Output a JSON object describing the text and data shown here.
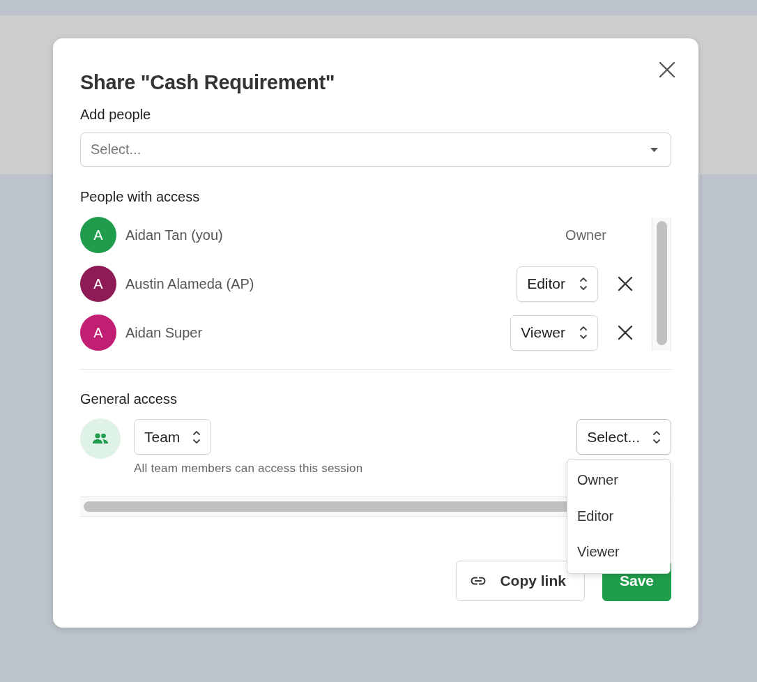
{
  "dialog": {
    "title": "Share \"Cash Requirement\""
  },
  "add_people": {
    "label": "Add people",
    "placeholder": "Select..."
  },
  "people_with_access": {
    "label": "People with access",
    "people": [
      {
        "initial": "A",
        "name": "Aidan Tan (you)",
        "color": "#1f9d4c",
        "kind": "fixed",
        "role": "Owner"
      },
      {
        "initial": "A",
        "name": "Austin Alameda (AP)",
        "color": "#8e1a56",
        "kind": "select",
        "role": "Editor"
      },
      {
        "initial": "A",
        "name": "Aidan Super",
        "color": "#c01f74",
        "kind": "select",
        "role": "Viewer"
      }
    ]
  },
  "general_access": {
    "label": "General access",
    "scope": "Team",
    "description": "All team members can access this session",
    "role_select": {
      "value": "Select...",
      "expanded": true,
      "options": [
        {
          "label": "Owner",
          "selected": false
        },
        {
          "label": "Editor",
          "selected": false
        },
        {
          "label": "Viewer",
          "selected": false
        }
      ]
    }
  },
  "buttons": [
    {
      "kind": "secondary",
      "label": "Copy link"
    },
    {
      "kind": "primary",
      "label": "Save"
    }
  ]
}
